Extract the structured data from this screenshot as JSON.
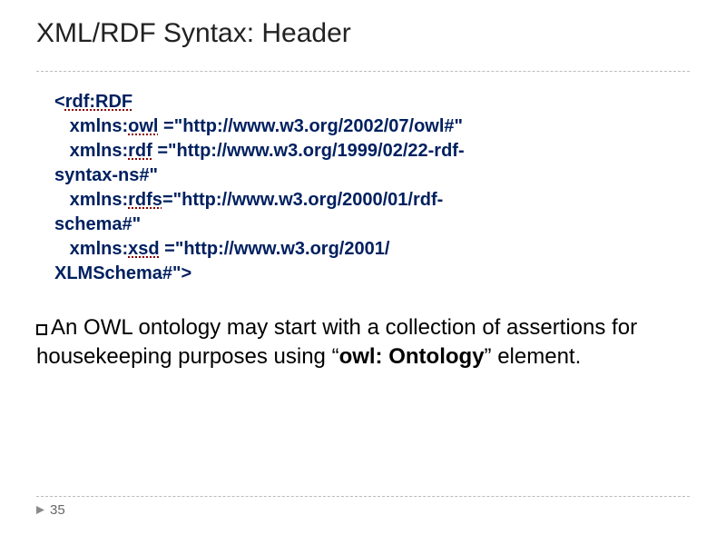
{
  "title": "XML/RDF Syntax: Header",
  "code": {
    "open_tag": "<",
    "rdf_rdf": "rdf:RDF",
    "line1_prefix": "xmlns:",
    "line1_kw": "owl",
    "line1_rest": " =\"http://www.w3.org/2002/07/owl#\"",
    "line2_prefix": "xmlns:",
    "line2_kw": "rdf",
    "line2_rest": " =\"http://www.w3.org/1999/02/22-rdf-",
    "line2b": "syntax-ns#\"",
    "line3_prefix": "xmlns:",
    "line3_kw": "rdfs",
    "line3_rest": "=\"http://www.w3.org/2000/01/rdf-",
    "line3b": "schema#\"",
    "line4_prefix": "xmlns:",
    "line4_kw": "xsd",
    "line4_rest": " =\"http://www.w3.org/2001/",
    "line4b": "XLMSchema#\">"
  },
  "body": {
    "part1": "An OWL ontology may start with a collection of assertions for housekeeping purposes using “",
    "bold1": "owl: Ontology",
    "part2": "” element."
  },
  "footer": {
    "page_number": "35"
  }
}
